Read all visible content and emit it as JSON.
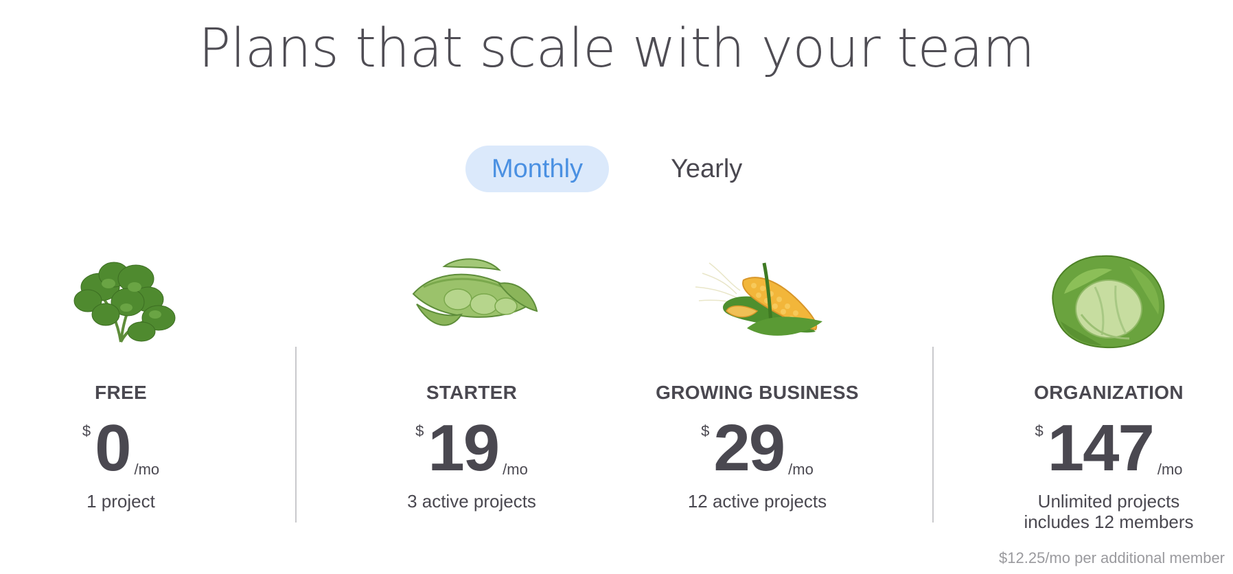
{
  "headline": "Plans that scale with your team",
  "billing_toggle": {
    "monthly_label": "Monthly",
    "yearly_label": "Yearly",
    "selected": "Monthly",
    "active_color": "#4a90e2",
    "active_bg": "#dbe9fb"
  },
  "plans": [
    {
      "image_icon": "parsley-icon",
      "name": "FREE",
      "currency": "$",
      "amount": "0",
      "period": "/mo",
      "description_line1": "1 project",
      "description_line2": ""
    },
    {
      "image_icon": "edamame-icon",
      "name": "STARTER",
      "currency": "$",
      "amount": "19",
      "period": "/mo",
      "description_line1": "3 active projects",
      "description_line2": ""
    },
    {
      "image_icon": "corn-icon",
      "name": "GROWING BUSINESS",
      "currency": "$",
      "amount": "29",
      "period": "/mo",
      "description_line1": "12 active projects",
      "description_line2": ""
    },
    {
      "image_icon": "cabbage-icon",
      "name": "ORGANIZATION",
      "currency": "$",
      "amount": "147",
      "period": "/mo",
      "description_line1": "Unlimited projects",
      "description_line2": "includes 12 members"
    }
  ],
  "additional_member_note": "$12.25/mo per additional member"
}
